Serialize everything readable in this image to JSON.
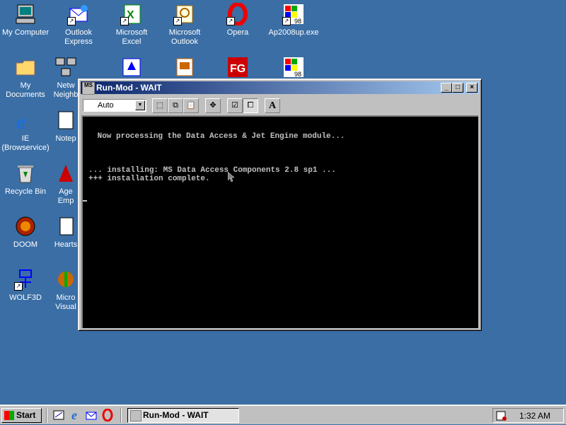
{
  "desktop": {
    "icons": [
      {
        "label": "My Computer",
        "icon": "computer-icon"
      },
      {
        "label": "Outlook\nExpress",
        "icon": "outlook-express-icon"
      },
      {
        "label": "Microsoft\nExcel",
        "icon": "excel-icon"
      },
      {
        "label": "Microsoft\nOutlook",
        "icon": "outlook-icon"
      },
      {
        "label": "Opera",
        "icon": "opera-icon"
      },
      {
        "label": "Ap2008up.exe",
        "icon": "windows98-setup-icon"
      },
      {
        "label": "My Documents",
        "icon": "folder-icon"
      },
      {
        "label": "Netw\nNeighb",
        "icon": "network-icon"
      },
      {
        "label": "IE\n(Browservice)",
        "icon": "internet-explorer-icon"
      },
      {
        "label": "Notep",
        "icon": "notepad-icon"
      },
      {
        "label": "Recycle Bin",
        "icon": "recycle-bin-icon"
      },
      {
        "label": "Age\nEmp",
        "icon": "age-of-empires-icon"
      },
      {
        "label": "DOOM",
        "icon": "doom-icon"
      },
      {
        "label": "Hearts",
        "icon": "hearts-icon"
      },
      {
        "label": "WOLF3D",
        "icon": "wolf3d-icon"
      },
      {
        "label": "Micro\nVisual",
        "icon": "visual-studio-icon"
      }
    ]
  },
  "window": {
    "title": "Run-Mod - WAIT",
    "toolbar": {
      "font_size_value": "Auto",
      "buttons": [
        "mark-icon",
        "copy-icon",
        "paste-icon",
        "fullscreen-icon",
        "properties-icon",
        "background-icon",
        "font-icon"
      ]
    },
    "console_lines": [
      " Now processing the Data Access & Jet Engine module...",
      "... installing: MS Data Access Components 2.8 sp1 ...",
      "+++ installation complete."
    ]
  },
  "taskbar": {
    "start_label": "Start",
    "task_label": "Run-Mod - WAIT",
    "clock": "1:32 AM"
  },
  "colors": {
    "desktop": "#3a6ea5",
    "titlebar_start": "#0a246a",
    "titlebar_end": "#a6caf0",
    "console_bg": "#000000",
    "console_text": "#c0c0c0"
  }
}
